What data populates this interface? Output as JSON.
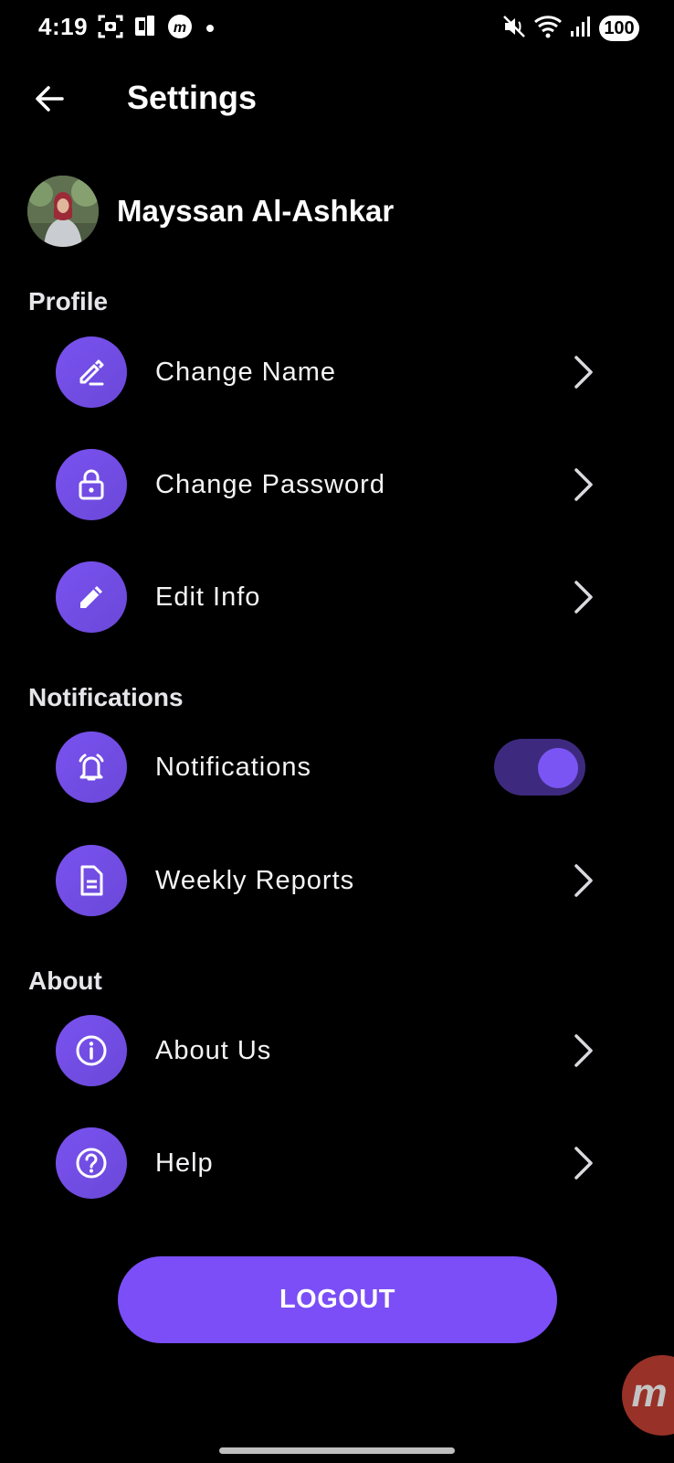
{
  "status_bar": {
    "time": "4:19",
    "battery": "100",
    "left_icons": [
      "screenshot-icon",
      "cast-icon",
      "m-app-icon",
      "dot"
    ],
    "right_icons": [
      "mute-vibrate-icon",
      "wifi-icon",
      "signal-icon"
    ]
  },
  "header": {
    "title": "Settings",
    "back_icon": "arrow-left-icon"
  },
  "user": {
    "name": "Mayssan Al-Ashkar"
  },
  "sections": {
    "profile": {
      "title": "Profile",
      "items": [
        {
          "label": "Change Name",
          "icon": "pen-icon"
        },
        {
          "label": "Change Password",
          "icon": "lock-icon"
        },
        {
          "label": "Edit Info",
          "icon": "pencil-icon"
        }
      ]
    },
    "notifications": {
      "title": "Notifications",
      "items": [
        {
          "label": "Notifications",
          "icon": "bell-icon",
          "toggle_on": true
        },
        {
          "label": "Weekly Reports",
          "icon": "document-icon"
        }
      ]
    },
    "about": {
      "title": "About",
      "items": [
        {
          "label": "About Us",
          "icon": "info-icon"
        },
        {
          "label": "Help",
          "icon": "help-icon"
        }
      ]
    }
  },
  "logout": {
    "label": "LOGOUT"
  },
  "colors": {
    "background": "#000000",
    "accent": "#7b4ef7",
    "icon_circle": "#7352e8",
    "toggle_track": "#3d2a7e"
  }
}
